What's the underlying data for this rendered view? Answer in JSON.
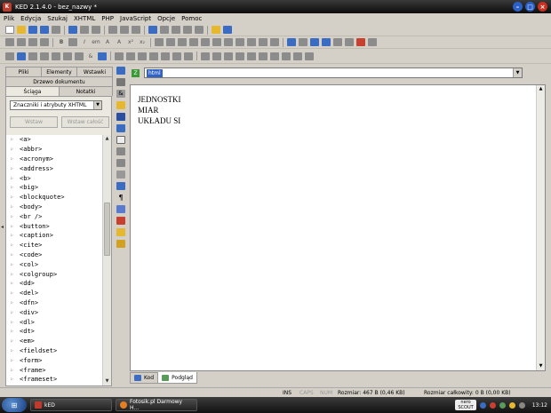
{
  "window": {
    "title": "KED 2.1.4.0 - bez_nazwy *",
    "app_icon": "K"
  },
  "menu": [
    "Plik",
    "Edycja",
    "Szukaj",
    "XHTML",
    "PHP",
    "JavaScript",
    "Opcje",
    "Pomoc"
  ],
  "left": {
    "tabs_row1": [
      "Pliki",
      "Elementy",
      "Wstawki"
    ],
    "tab_doc": "Drzewo dokumentu",
    "tabs_row2": [
      "Ściąga",
      "Notatki"
    ],
    "select_value": "Znaczniki i atrybuty XHTML",
    "insert_button": "Wstaw",
    "insert_all_button": "Wstaw całość",
    "tags": [
      "<a>",
      "<abbr>",
      "<acronym>",
      "<address>",
      "<b>",
      "<big>",
      "<blockquote>",
      "<body>",
      "<br />",
      "<button>",
      "<caption>",
      "<cite>",
      "<code>",
      "<col>",
      "<colgroup>",
      "<dd>",
      "<del>",
      "<dfn>",
      "<div>",
      "<dl>",
      "<dt>",
      "<em>",
      "<fieldset>",
      "<form>",
      "<frame>",
      "<frameset>"
    ]
  },
  "editor": {
    "combo_value": "html",
    "lines": [
      "JEDNOSTKI",
      "MIAR",
      "UKŁADU SI"
    ],
    "bottom_tabs": [
      "Kod",
      "Podgląd"
    ]
  },
  "status": {
    "ins": "INS",
    "caps": "CAPS",
    "num": "NUM",
    "size": "Rozmiar: 467 B (0,46 KB)",
    "total": "Rozmiar całkowity: 0 B (0,00 KB)"
  },
  "taskbar": {
    "tasks": [
      "kED",
      "Fotosik.pl Darmowy H..."
    ],
    "tray_brand": "nero",
    "tray_brand_sub": "SCOUT",
    "clock": "13:12"
  },
  "colors": {
    "accent": "#3163c5",
    "titlebar": "#0c0c0c"
  }
}
